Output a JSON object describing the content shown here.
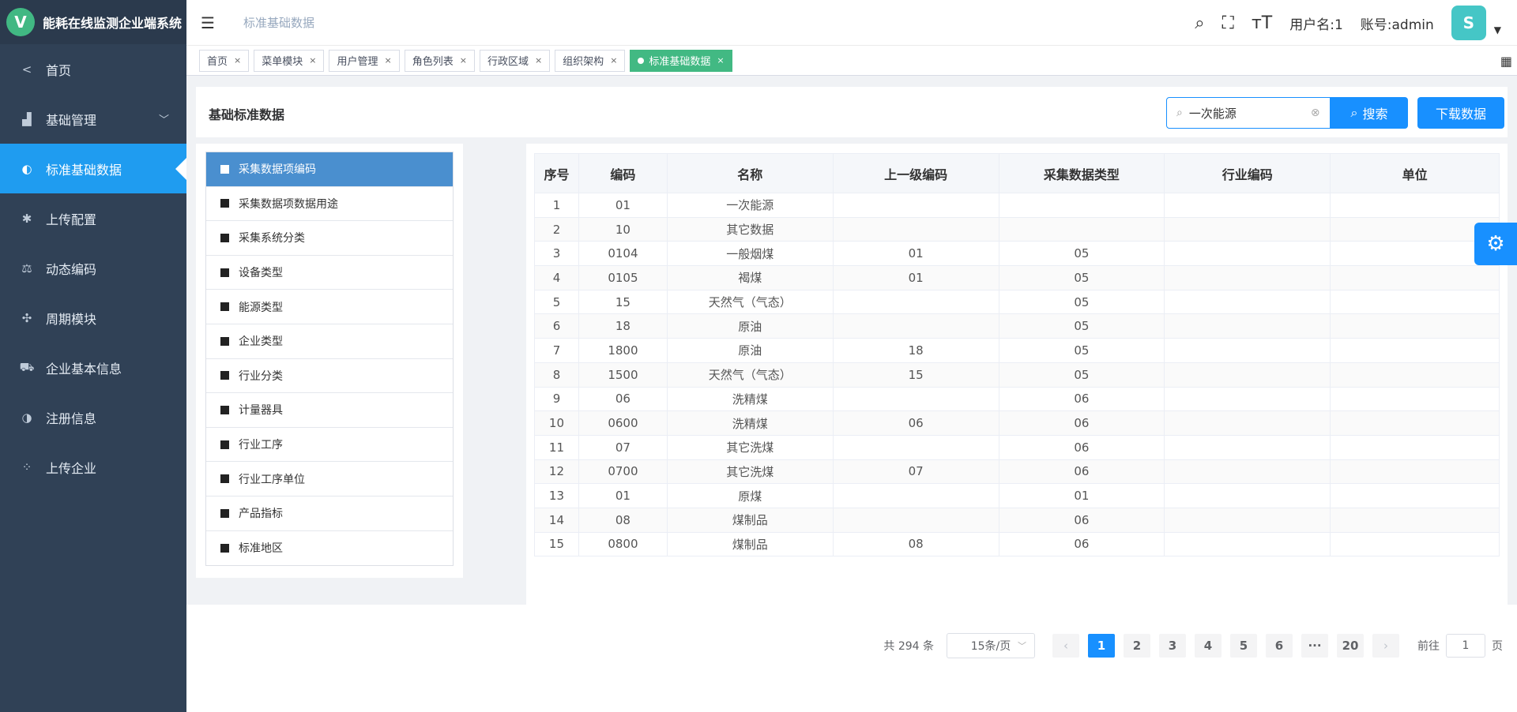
{
  "app": {
    "logo_letter": "V",
    "title": "能耗在线监测企业端系统"
  },
  "sidebar": {
    "items": [
      {
        "label": "首页",
        "icon": "share-icon"
      },
      {
        "label": "基础管理",
        "icon": "chart-area-icon"
      },
      {
        "label": "标准基础数据",
        "icon": "half-circle-icon"
      },
      {
        "label": "上传配置",
        "icon": "asterisk-icon"
      },
      {
        "label": "动态编码",
        "icon": "scale-icon"
      },
      {
        "label": "周期模块",
        "icon": "move-icon"
      },
      {
        "label": "企业基本信息",
        "icon": "car-icon"
      },
      {
        "label": "注册信息",
        "icon": "half-circle-icon"
      },
      {
        "label": "上传企业",
        "icon": "grid-dots-icon"
      }
    ]
  },
  "header": {
    "breadcrumb": "标准基础数据",
    "username": "用户名:1",
    "account": "账号:admin",
    "avatar_letter": "S"
  },
  "tags": [
    {
      "label": "首页"
    },
    {
      "label": "菜单模块"
    },
    {
      "label": "用户管理"
    },
    {
      "label": "角色列表"
    },
    {
      "label": "行政区域"
    },
    {
      "label": "组织架构"
    },
    {
      "label": "标准基础数据"
    }
  ],
  "panel": {
    "title": "基础标准数据",
    "search_value": "一次能源",
    "search_label": "搜索",
    "download_label": "下载数据"
  },
  "categories": [
    "采集数据项编码",
    "采集数据项数据用途",
    "采集系统分类",
    "设备类型",
    "能源类型",
    "企业类型",
    "行业分类",
    "计量器具",
    "行业工序",
    "行业工序单位",
    "产品指标",
    "标准地区"
  ],
  "table": {
    "headers": [
      "序号",
      "编码",
      "名称",
      "上一级编码",
      "采集数据类型",
      "行业编码",
      "单位"
    ],
    "rows": [
      [
        "1",
        "01",
        "一次能源",
        "",
        "",
        "",
        ""
      ],
      [
        "2",
        "10",
        "其它数据",
        "",
        "",
        "",
        ""
      ],
      [
        "3",
        "0104",
        "一般烟煤",
        "01",
        "05",
        "",
        ""
      ],
      [
        "4",
        "0105",
        "褐煤",
        "01",
        "05",
        "",
        ""
      ],
      [
        "5",
        "15",
        "天然气（气态）",
        "",
        "05",
        "",
        ""
      ],
      [
        "6",
        "18",
        "原油",
        "",
        "05",
        "",
        ""
      ],
      [
        "7",
        "1800",
        "原油",
        "18",
        "05",
        "",
        ""
      ],
      [
        "8",
        "1500",
        "天然气（气态）",
        "15",
        "05",
        "",
        ""
      ],
      [
        "9",
        "06",
        "洗精煤",
        "",
        "06",
        "",
        ""
      ],
      [
        "10",
        "0600",
        "洗精煤",
        "06",
        "06",
        "",
        ""
      ],
      [
        "11",
        "07",
        "其它洗煤",
        "",
        "06",
        "",
        ""
      ],
      [
        "12",
        "0700",
        "其它洗煤",
        "07",
        "06",
        "",
        ""
      ],
      [
        "13",
        "01",
        "原煤",
        "",
        "01",
        "",
        ""
      ],
      [
        "14",
        "08",
        "煤制品",
        "",
        "06",
        "",
        ""
      ],
      [
        "15",
        "0800",
        "煤制品",
        "08",
        "06",
        "",
        ""
      ]
    ]
  },
  "pager": {
    "total": "共 294 条",
    "page_size": "15条/页",
    "pages": [
      "1",
      "2",
      "3",
      "4",
      "5",
      "6",
      "···",
      "20"
    ],
    "goto_label": "前往",
    "goto_value": "1",
    "page_suffix": "页"
  },
  "colors": {
    "sidebar_bg": "#304156",
    "accent": "#1890ff",
    "tag_active": "#42b983",
    "category_active": "#4a8fcf"
  }
}
